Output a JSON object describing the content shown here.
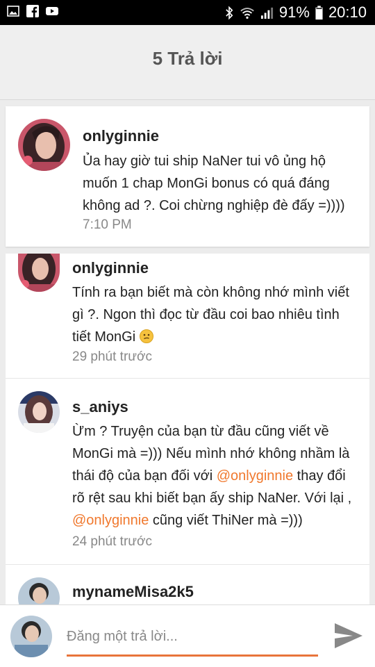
{
  "status_bar": {
    "battery": "91%",
    "time": "20:10",
    "left_icons": [
      "image-icon",
      "facebook-icon",
      "youtube-icon"
    ],
    "right_icons": [
      "bluetooth-icon",
      "wifi-icon",
      "signal-icon",
      "battery-icon"
    ]
  },
  "header": {
    "title": "5 Trả lời"
  },
  "main_comment": {
    "username": "onlyginnie",
    "text": "Ủa hay giờ tui ship NaNer tui vô ủng hộ muốn 1 chap MonGi bonus có quá đáng không ad ?. Coi chừng nghiệp đè đấy =))))",
    "time": "7:10 PM"
  },
  "replies": [
    {
      "username": "onlyginnie",
      "text": "Tính ra bạn biết mà còn không nhớ mình viết gì ?. Ngon thì đọc từ đầu coi bao nhiêu tình tiết MonGi",
      "emoji": "confused-face-icon",
      "time": "29 phút trước"
    },
    {
      "username": "s_aniys",
      "text_1": "Ừm ? Truyện của bạn từ đầu cũng viết về MonGi mà =))) Nếu mình nhớ không nhầm là thái độ của bạn đối với ",
      "mention_1": "@onlyginnie",
      "text_2": " thay đổi rõ rệt sau khi biết bạn ấy ship NaNer. Với lại , ",
      "mention_2": "@onlyginnie",
      "text_3": " cũng viết ThiNer mà =)))",
      "time": "24 phút trước"
    },
    {
      "username": "mynameMisa2k5"
    }
  ],
  "composer": {
    "placeholder": "Đăng một trả lời...",
    "value": ""
  },
  "colors": {
    "accent": "#f0782d",
    "underline": "#e8743b",
    "header_bg": "#efefef",
    "page_bg": "#ececec"
  }
}
